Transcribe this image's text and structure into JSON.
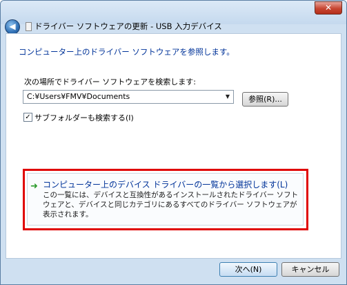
{
  "window": {
    "title": "ドライバー ソフトウェアの更新 - USB 入力デバイス",
    "close_glyph": "✕",
    "back_glyph": "◀"
  },
  "main": {
    "heading": "コンピューター上のドライバー ソフトウェアを参照します。",
    "search_label": "次の場所でドライバー ソフトウェアを検索します:",
    "path_value": "C:¥Users¥FMV¥Documents",
    "combo_arrow": "▼",
    "browse_label": "参照(R)...",
    "subfolder_checked": true,
    "subfolder_check_glyph": "✓",
    "subfolder_label": "サブフォルダーも検索する(I)"
  },
  "option": {
    "arrow": "➜",
    "title": "コンピューター上のデバイス ドライバーの一覧から選択します(L)",
    "description": "この一覧には、デバイスと互換性があるインストールされたドライバー ソフトウェアと、デバイスと同じカテゴリにあるすべてのドライバー ソフトウェアが表示されます。"
  },
  "footer": {
    "next_label": "次へ(N)",
    "cancel_label": "キャンセル"
  },
  "colors": {
    "heading": "#003399",
    "highlight": "#e00000",
    "arrow": "#2a9a2a"
  }
}
